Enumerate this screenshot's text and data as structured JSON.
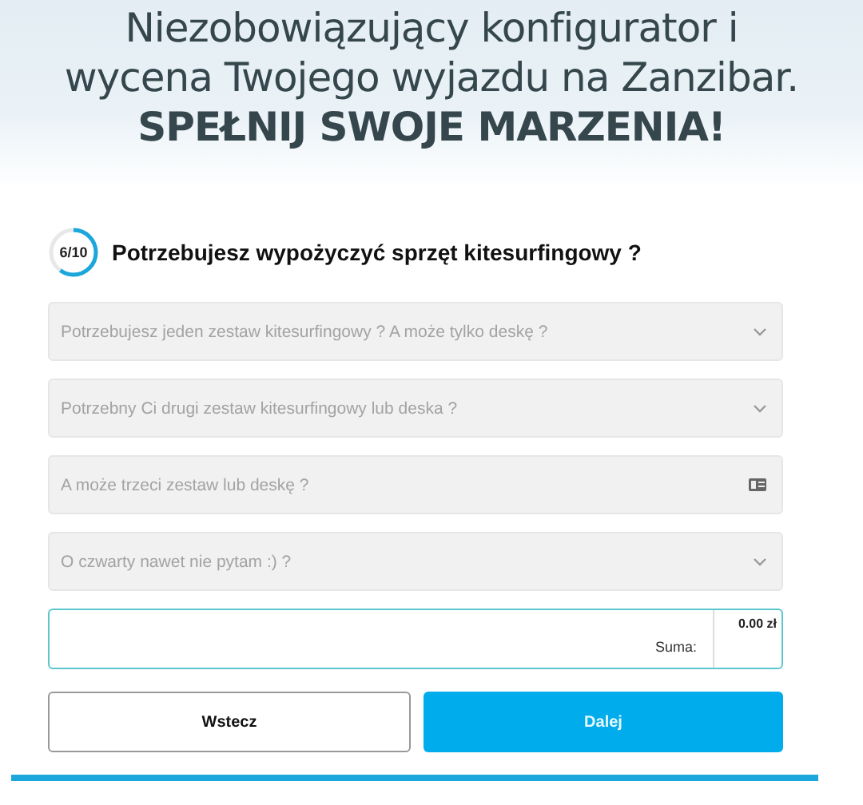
{
  "hero": {
    "heading": "Niezobowiązujący konfigurator i wycena Twojego wyjazdu na Zanzibar. **SPEŁNIJ SWOJE MARZENIA!**"
  },
  "step": {
    "counter": "6/10",
    "level": 0.6,
    "question": "Potrzebujesz wypożyczyć sprzęt kitesurfingowy ?"
  },
  "fields": [
    {
      "kind": "select",
      "placeholder": "Potrzebujesz jeden zestaw kitesurfingowy ? A może tylko deskę ?"
    },
    {
      "kind": "select",
      "placeholder": "Potrzebny Ci drugi zestaw kitesurfingowy lub deska ?"
    },
    {
      "kind": "input",
      "placeholder": "A może trzeci zestaw lub deskę ?"
    },
    {
      "kind": "select",
      "placeholder": "O czwarty nawet nie pytam :) ?"
    }
  ],
  "summary": {
    "label": "Suma:",
    "value": "0.00 zł"
  },
  "buttons": [
    {
      "label": "Wstecz",
      "kind": "secondary"
    },
    {
      "label": "Dalej",
      "kind": "primary"
    }
  ]
}
